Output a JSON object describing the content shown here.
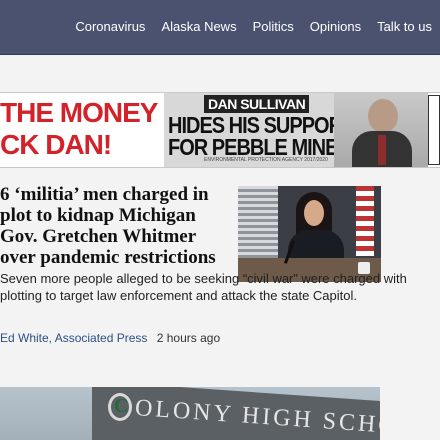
{
  "nav": {
    "items": [
      "Coronavirus",
      "Alaska News",
      "Politics",
      "Opinions",
      "Talk to us"
    ]
  },
  "ad": {
    "left_line1": "THE MONEY",
    "left_line2": "CK DAN!",
    "tag": "DAN SULLIVAN",
    "headline_line1": "HIDES HIS SUPPORT",
    "headline_line2": "FOR PEBBLE MINE",
    "fine_print": "ENVIRONMENTAL PROTECTION AGENCY 2017/2020"
  },
  "article": {
    "headline": "6 ‘militia’ men charged in plot to kidnap Michigan Gov. Gretchen Whitmer over pandemic restrictions",
    "summary": "Seven more people alleged to be seeking “civil war” were charged with plotting to target law enforcement and attack the state Capitol.",
    "author": "Ed White, Associated Press",
    "time": "2 hours ago"
  },
  "next_photo": {
    "logo_letter": "C",
    "sign_text": "OLONY HIGH SCHO"
  },
  "colors": {
    "topbar": "#4a5270",
    "ad_red": "#d4222b",
    "author_link": "#2d4f86"
  }
}
